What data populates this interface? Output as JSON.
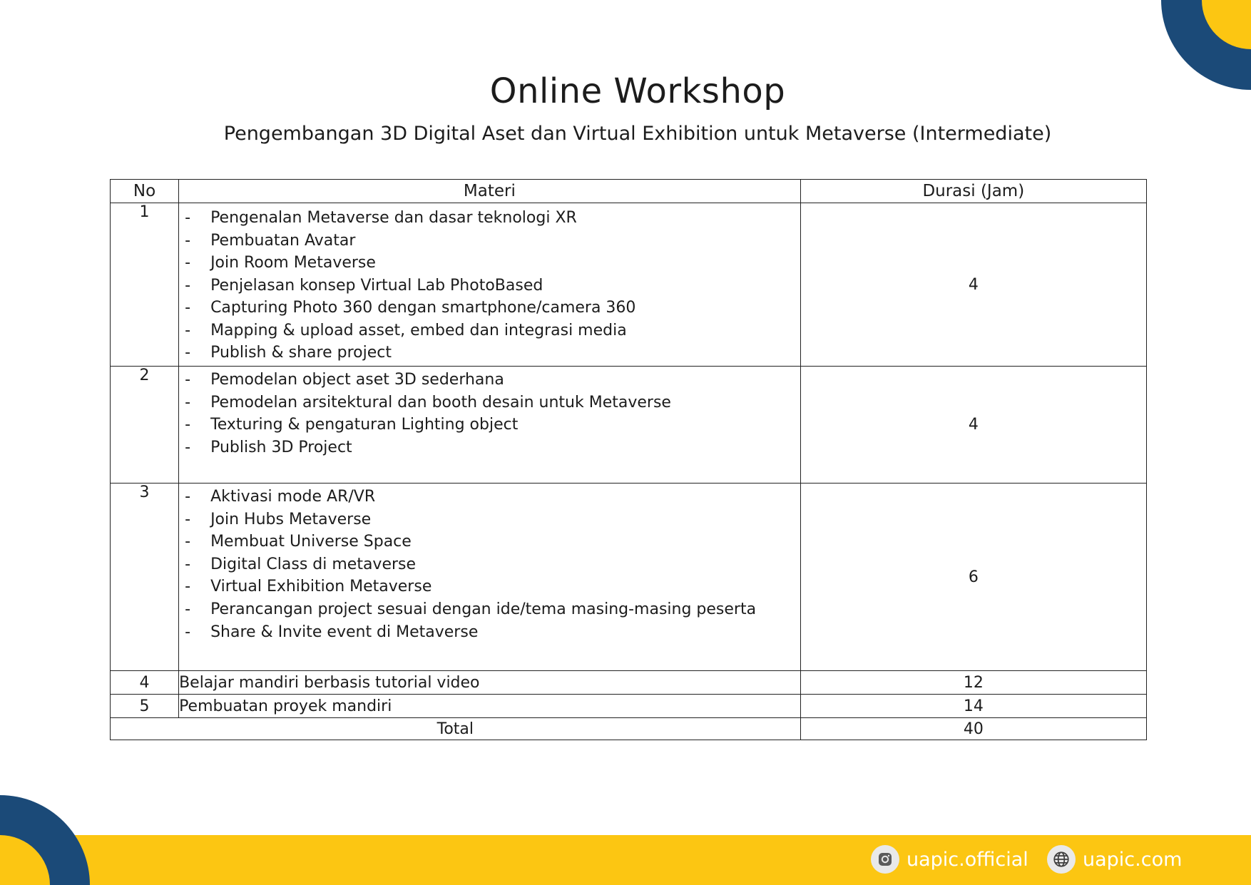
{
  "header": {
    "title": "Online Workshop",
    "subtitle": "Pengembangan 3D Digital Aset dan Virtual Exhibition untuk Metaverse (Intermediate)"
  },
  "table": {
    "headers": {
      "no": "No",
      "materi": "Materi",
      "durasi": "Durasi (Jam)"
    },
    "rows": [
      {
        "no": "1",
        "items": [
          "Pengenalan Metaverse dan dasar teknologi XR",
          "Pembuatan Avatar",
          "Join Room Metaverse",
          "Penjelasan konsep Virtual Lab PhotoBased",
          "Capturing Photo 360 dengan smartphone/camera 360",
          "Mapping & upload asset, embed dan integrasi media",
          "Publish & share project"
        ],
        "durasi": "4"
      },
      {
        "no": "2",
        "items": [
          "Pemodelan object aset 3D sederhana",
          "Pemodelan arsitektural dan booth desain untuk Metaverse",
          "Texturing &  pengaturan Lighting object",
          "Publish 3D Project"
        ],
        "durasi": "4"
      },
      {
        "no": "3",
        "items": [
          "Aktivasi mode AR/VR",
          "Join Hubs Metaverse",
          "Membuat Universe Space",
          "Digital Class di metaverse",
          "Virtual Exhibition Metaverse",
          "Perancangan project sesuai dengan ide/tema masing-masing peserta",
          "Share & Invite event di Metaverse"
        ],
        "durasi": "6"
      },
      {
        "no": "4",
        "materi": "Belajar mandiri berbasis tutorial video",
        "durasi": "12"
      },
      {
        "no": "5",
        "materi": "Pembuatan proyek mandiri",
        "durasi": "14"
      }
    ],
    "total": {
      "label": "Total",
      "value": "40"
    }
  },
  "footer": {
    "instagram": "uapic.official",
    "website": "uapic.com"
  },
  "colors": {
    "navy": "#1b4a78",
    "yellow": "#fcc612",
    "text": "#1c1c1c"
  },
  "icons": [
    "instagram-icon",
    "globe-icon"
  ]
}
